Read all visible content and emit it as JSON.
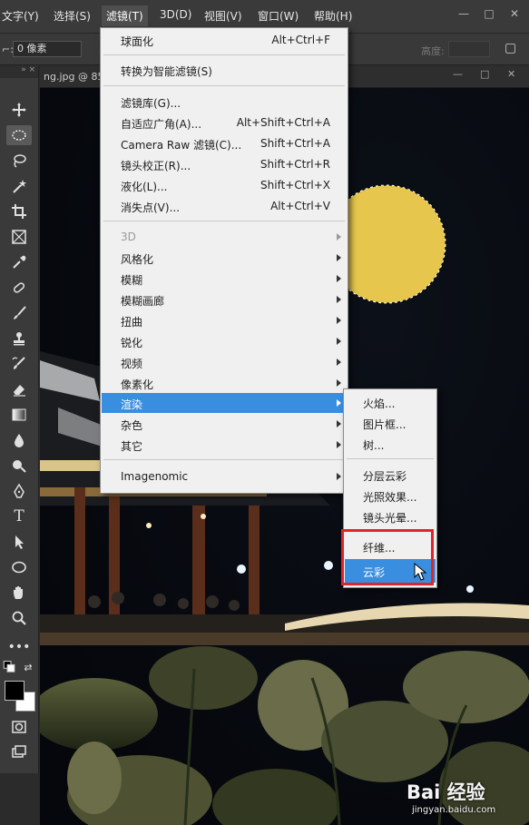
{
  "menubar": {
    "items": [
      "文字(Y)",
      "选择(S)",
      "滤镜(T)",
      "3D(D)",
      "视图(V)",
      "窗口(W)",
      "帮助(H)"
    ],
    "active": "滤镜(T)"
  },
  "options": {
    "feather_value": "0 像素",
    "height_label": "高度:"
  },
  "document": {
    "tab_title": "ng.jpg @ 85"
  },
  "toolbar": {
    "tools": [
      "move-tool",
      "elliptical-marquee-tool",
      "lasso-tool",
      "magic-wand-tool",
      "crop-tool",
      "frame-tool",
      "eyedropper-tool",
      "healing-brush-tool",
      "brush-tool",
      "clone-stamp-tool",
      "history-brush-tool",
      "eraser-tool",
      "gradient-tool",
      "blur-tool",
      "dodge-tool",
      "pen-tool",
      "type-tool",
      "path-selection-tool",
      "ellipse-tool",
      "hand-tool",
      "zoom-tool",
      "more-tools",
      "default-colors",
      "foreground-color",
      "quick-mask",
      "screen-mode"
    ],
    "foreground_color": "#000000",
    "background_color": "#ffffff"
  },
  "filter_menu": {
    "items": [
      {
        "label": "球面化",
        "shortcut": "Alt+Ctrl+F"
      },
      {
        "label": "转换为智能滤镜(S)",
        "shortcut": ""
      },
      {
        "label": "滤镜库(G)...",
        "shortcut": ""
      },
      {
        "label": "自适应广角(A)...",
        "shortcut": "Alt+Shift+Ctrl+A"
      },
      {
        "label": "Camera Raw 滤镜(C)...",
        "shortcut": "Shift+Ctrl+A"
      },
      {
        "label": "镜头校正(R)...",
        "shortcut": "Shift+Ctrl+R"
      },
      {
        "label": "液化(L)...",
        "shortcut": "Shift+Ctrl+X"
      },
      {
        "label": "消失点(V)...",
        "shortcut": "Alt+Ctrl+V"
      },
      {
        "label": "3D",
        "shortcut": ""
      },
      {
        "label": "风格化",
        "shortcut": ""
      },
      {
        "label": "模糊",
        "shortcut": ""
      },
      {
        "label": "模糊画廊",
        "shortcut": ""
      },
      {
        "label": "扭曲",
        "shortcut": ""
      },
      {
        "label": "锐化",
        "shortcut": ""
      },
      {
        "label": "视频",
        "shortcut": ""
      },
      {
        "label": "像素化",
        "shortcut": ""
      },
      {
        "label": "渲染",
        "shortcut": ""
      },
      {
        "label": "杂色",
        "shortcut": ""
      },
      {
        "label": "其它",
        "shortcut": ""
      },
      {
        "label": "Imagenomic",
        "shortcut": ""
      }
    ]
  },
  "render_submenu": {
    "items": [
      {
        "label": "火焰..."
      },
      {
        "label": "图片框..."
      },
      {
        "label": "树..."
      },
      {
        "label": "分层云彩"
      },
      {
        "label": "光照效果..."
      },
      {
        "label": "镜头光晕..."
      },
      {
        "label": "纤维..."
      },
      {
        "label": "云彩"
      }
    ],
    "highlight_color": "#e0242a",
    "selected_color": "#3a8ee0"
  },
  "canvas": {
    "moon_color": "#e6c64c",
    "sky_color": "#070a10"
  },
  "watermark": {
    "logo": "Bai 经验",
    "url": "jingyan.baidu.com"
  }
}
